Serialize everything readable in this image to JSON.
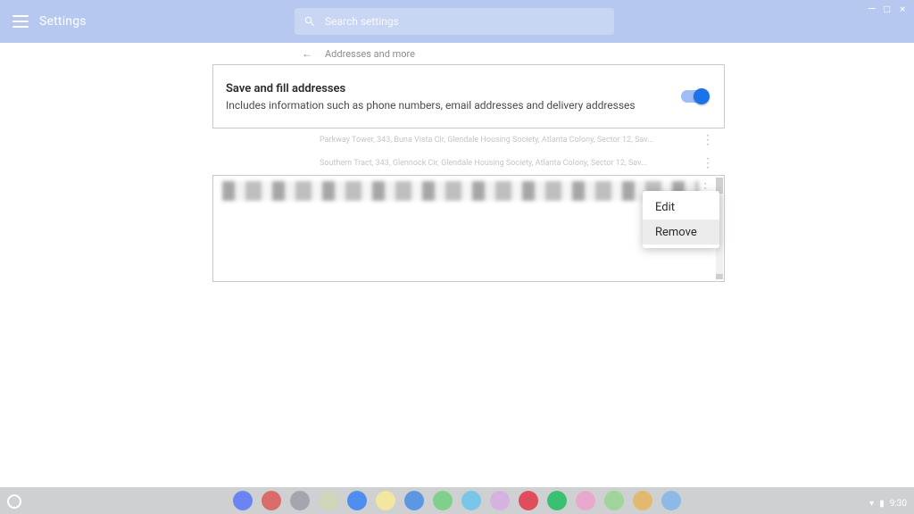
{
  "header": {
    "app_title": "Settings",
    "search_placeholder": "Search settings"
  },
  "breadcrumb": {
    "page_label": "Addresses and more"
  },
  "toggle_card": {
    "title": "Save and fill addresses",
    "subtitle": "Includes information such as phone numbers, email addresses and delivery addresses",
    "enabled": true
  },
  "addresses": [
    {
      "summary": "Parkway Tower, 343, Buna Vista Cir, Glendale Housing Society, Atlanta Colony, Sector 12, Sav..."
    },
    {
      "summary": "Southern Tract, 343, Glennock Cir, Glendale Housing Society, Atlanta Colony, Sector 12, Sav..."
    }
  ],
  "context_menu": {
    "items": [
      {
        "label": "Edit"
      },
      {
        "label": "Remove"
      }
    ],
    "highlighted_index": 1
  },
  "taskbar": {
    "clock": "9:30",
    "app_colors": [
      "#6b84f3",
      "#d96b6b",
      "#a3a7ad",
      "#cfd6b9",
      "#4f8ef0",
      "#f2e6a1",
      "#5b97e2",
      "#7fd08b",
      "#7ac6ea",
      "#d5b2e0",
      "#e04d5d",
      "#39c072",
      "#e9a9cf",
      "#9fd49b",
      "#e2ba6f",
      "#8cb9e6"
    ]
  },
  "colors": {
    "accent": "#1a73e8",
    "header_bg": "#b6c8ef"
  }
}
